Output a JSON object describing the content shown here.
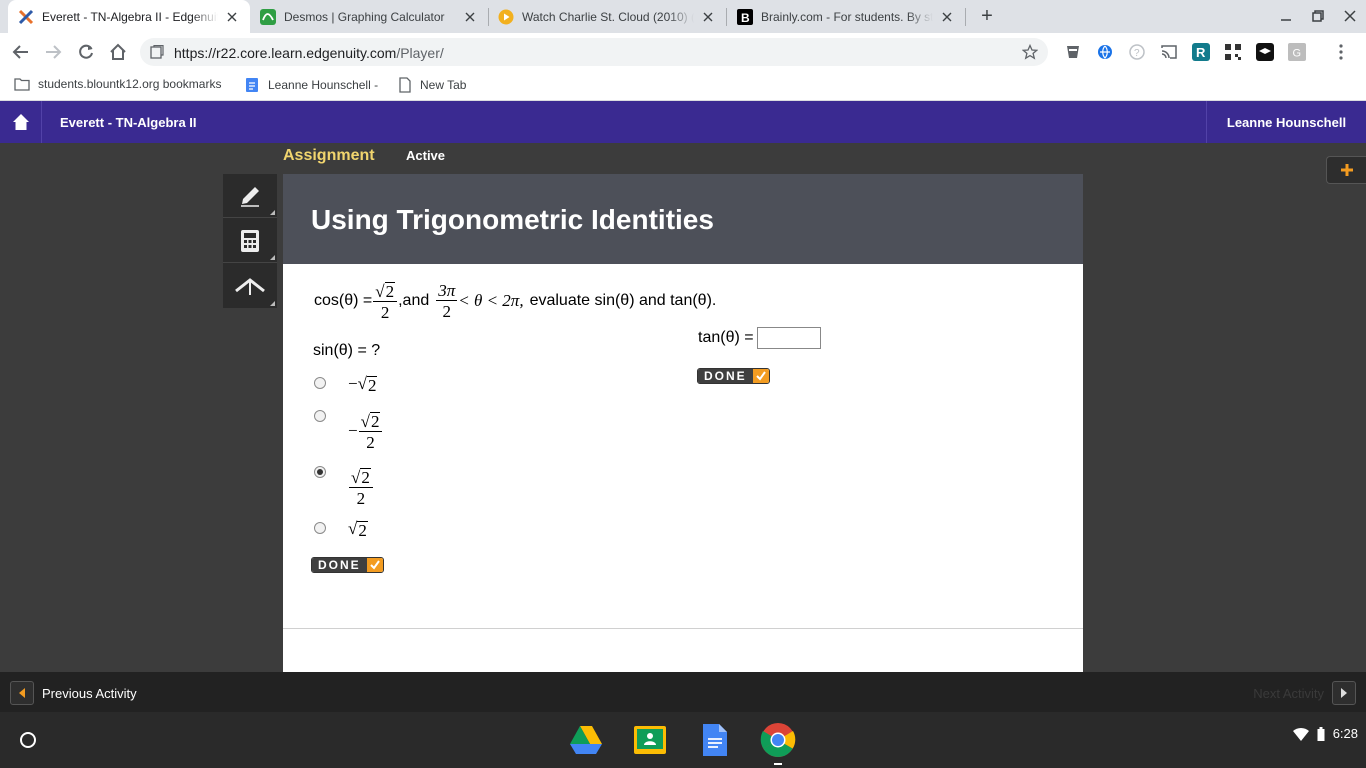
{
  "browser": {
    "tabs": [
      {
        "title": "Everett - TN-Algebra II - Edgenuit",
        "favicon": "edgenuity-x-icon",
        "active": true
      },
      {
        "title": "Desmos | Graphing Calculator",
        "favicon": "desmos-icon",
        "active": false
      },
      {
        "title": "Watch Charlie St. Cloud (2010) (",
        "favicon": "play-icon",
        "active": false
      },
      {
        "title": "Brainly.com - For students. By st",
        "favicon": "brainly-icon",
        "active": false
      }
    ],
    "new_tab_symbol": "+",
    "address": {
      "host": "https://r22.core.learn.edgenuity.com",
      "path": "/Player/"
    },
    "bookmarks": [
      {
        "label": "students.blountk12.org bookmarks",
        "icon": "folder-icon"
      },
      {
        "label": "Leanne Hounschell -",
        "icon": "docs-icon"
      },
      {
        "label": "New Tab",
        "icon": "page-icon"
      }
    ]
  },
  "app": {
    "course_title": "Everett - TN-Algebra II",
    "user_name": "Leanne Hounschell",
    "assignment_label": "Assignment",
    "status_label": "Active",
    "lesson_title": "Using Trigonometric Identities",
    "accent_color": "#3a2a91"
  },
  "question": {
    "cos_lhs": "cos(θ) =",
    "cos_value": {
      "numerator": "2",
      "denominator": "2"
    },
    "and_text": ",and",
    "range_lower": {
      "numerator": "3π",
      "denominator": "2"
    },
    "range_middle": "< θ < 2π,",
    "prompt_tail": "evaluate sin(θ) and tan(θ).",
    "sin_prompt": "sin(θ) = ?",
    "tan_label": "tan(θ) =",
    "tan_value": "",
    "options": [
      {
        "sign": "−",
        "radicand": "2",
        "denominator": "",
        "selected": false
      },
      {
        "sign": "−",
        "radicand": "2",
        "denominator": "2",
        "selected": false
      },
      {
        "sign": "",
        "radicand": "2",
        "denominator": "2",
        "selected": true
      },
      {
        "sign": "",
        "radicand": "2",
        "denominator": "",
        "selected": false
      }
    ],
    "done_label": "DONE"
  },
  "footer": {
    "prev_label": "Previous Activity",
    "next_label": "Next Activity"
  },
  "shelf": {
    "apps": [
      "drive-icon",
      "classroom-icon",
      "docs-icon",
      "chrome-icon"
    ],
    "time": "6:28"
  }
}
